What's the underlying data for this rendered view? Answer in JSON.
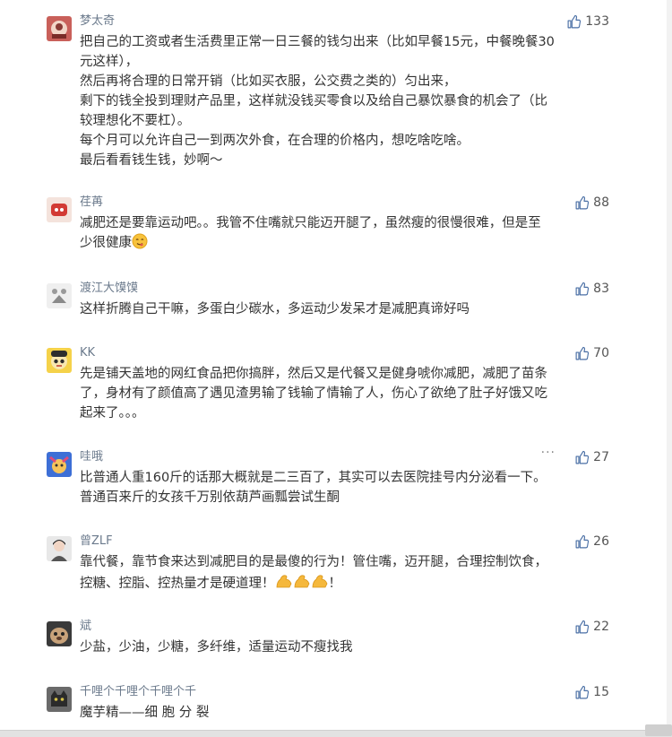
{
  "comments": [
    {
      "user": "梦太奇",
      "likes": "133",
      "lines": [
        "把自己的工资或者生活费里正常一日三餐的钱匀出来（比如早餐15元，中餐晚餐30",
        "元这样），",
        "然后再将合理的日常开销（比如买衣服，公交费之类的）匀出来，",
        "剩下的钱全投到理财产品里，这样就没钱买零食以及给自己暴饮暴食的机会了（比",
        "较理想化不要杠）。",
        "每个月可以允许自己一到两次外食，在合理的价格内，想吃啥吃啥。",
        "最后看看钱生钱，妙啊～"
      ]
    },
    {
      "user": "荏苒",
      "likes": "88",
      "lines": [
        "减肥还是要靠运动吧。。我管不住嘴就只能迈开腿了，虽然瘦的很慢很难，但是至",
        "少很健康"
      ],
      "emoji": "savoring-face-emoji"
    },
    {
      "user": "渡江大馍馍",
      "likes": "83",
      "lines": [
        "这样折腾自己干嘛，多蛋白少碳水，多运动少发呆才是减肥真谛好吗"
      ]
    },
    {
      "user": "KK",
      "likes": "70",
      "lines": [
        "先是铺天盖地的网红食品把你搞胖，然后又是代餐又是健身唬你减肥，减肥了苗条",
        "了，身材有了颜值高了遇见渣男输了钱输了情输了人，伤心了欲绝了肚子好饿又吃",
        "起来了。。。"
      ]
    },
    {
      "user": "哇哦",
      "likes": "27",
      "more": "···",
      "lines": [
        "比普通人重160斤的话那大概就是二三百了，其实可以去医院挂号内分泌看一下。",
        "普通百来斤的女孩千万别依葫芦画瓢尝试生酮"
      ]
    },
    {
      "user": "曾ZLF",
      "likes": "26",
      "lines": [
        "靠代餐，靠节食来达到减肥目的是最傻的行为！管住嘴，迈开腿，合理控制饮食，",
        "控糖、控脂、控热量才是硬道理！"
      ],
      "emoji_suffix": "！",
      "emoji": "flexed-biceps-emoji"
    },
    {
      "user": "斌",
      "likes": "22",
      "lines": [
        "少盐，少油，少糖，多纤维，适量运动不瘦找我"
      ]
    },
    {
      "user": "千哩个千哩个千哩个千",
      "likes": "15",
      "lines": [
        "魔芋精——细 胞 分 裂"
      ]
    }
  ],
  "icons": {
    "like": "thumbs-up-icon",
    "more": "more-options-icon"
  },
  "colors": {
    "username": "#6b7a8c",
    "text": "#333333",
    "like_icon": "#4a6fa5"
  }
}
